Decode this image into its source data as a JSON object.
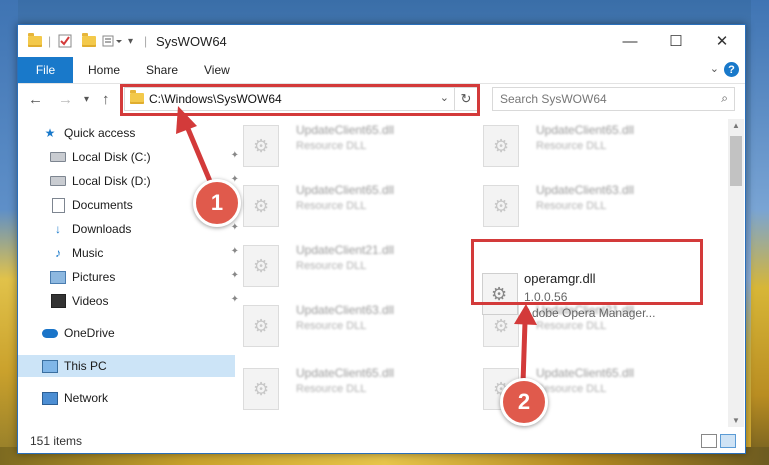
{
  "window": {
    "title": "SysWOW64",
    "controls": {
      "minimize": "—",
      "maximize": "☐",
      "close": "✕"
    }
  },
  "ribbon": {
    "tabs": [
      "File",
      "Home",
      "Share",
      "View"
    ],
    "help": "?"
  },
  "address": {
    "path": "C:\\Windows\\SysWOW64",
    "search_placeholder": "Search SysWOW64"
  },
  "sidebar": {
    "items": [
      {
        "label": "Quick access",
        "icon": "star-icon",
        "pinned": false
      },
      {
        "label": "Local Disk (C:)",
        "icon": "drive-icon",
        "pinned": true
      },
      {
        "label": "Local Disk (D:)",
        "icon": "drive-icon",
        "pinned": true
      },
      {
        "label": "Documents",
        "icon": "documents-icon",
        "pinned": true
      },
      {
        "label": "Downloads",
        "icon": "download-arrow-icon",
        "pinned": true
      },
      {
        "label": "Music",
        "icon": "music-note-icon",
        "pinned": true
      },
      {
        "label": "Pictures",
        "icon": "pictures-icon",
        "pinned": true
      },
      {
        "label": "Videos",
        "icon": "videos-icon",
        "pinned": true
      },
      {
        "label": "OneDrive",
        "icon": "cloud-icon",
        "pinned": false
      },
      {
        "label": "This PC",
        "icon": "computer-icon",
        "pinned": false,
        "selected": true
      },
      {
        "label": "Network",
        "icon": "network-icon",
        "pinned": false
      }
    ]
  },
  "files": {
    "blurred": [
      {
        "name": "UpdateClient65.dll",
        "desc": "Resource DLL"
      },
      {
        "name": "UpdateClient65.dll",
        "desc": "Resource DLL"
      },
      {
        "name": "UpdateClient65.dll",
        "desc": "Resource DLL"
      },
      {
        "name": "UpdateClient63.dll",
        "desc": "Resource DLL"
      },
      {
        "name": "UpdateClient21.dll",
        "desc": "Resource DLL"
      },
      {
        "name": "UpdateClient63.dll",
        "desc": "Resource DLL"
      },
      {
        "name": "UpdateClient21.dll",
        "desc": "Resource DLL"
      },
      {
        "name": "UpdateClient65.dll",
        "desc": "Resource DLL"
      },
      {
        "name": "UpdateClient65.dll",
        "desc": "Resource DLL"
      }
    ],
    "highlighted": {
      "name": "operamgr.dll",
      "version": "1.0.0.56",
      "description": "Adobe Opera Manager..."
    }
  },
  "status": {
    "item_count": "151 items"
  },
  "annotations": {
    "step1": "1",
    "step2": "2",
    "color": "#d33a3a"
  }
}
